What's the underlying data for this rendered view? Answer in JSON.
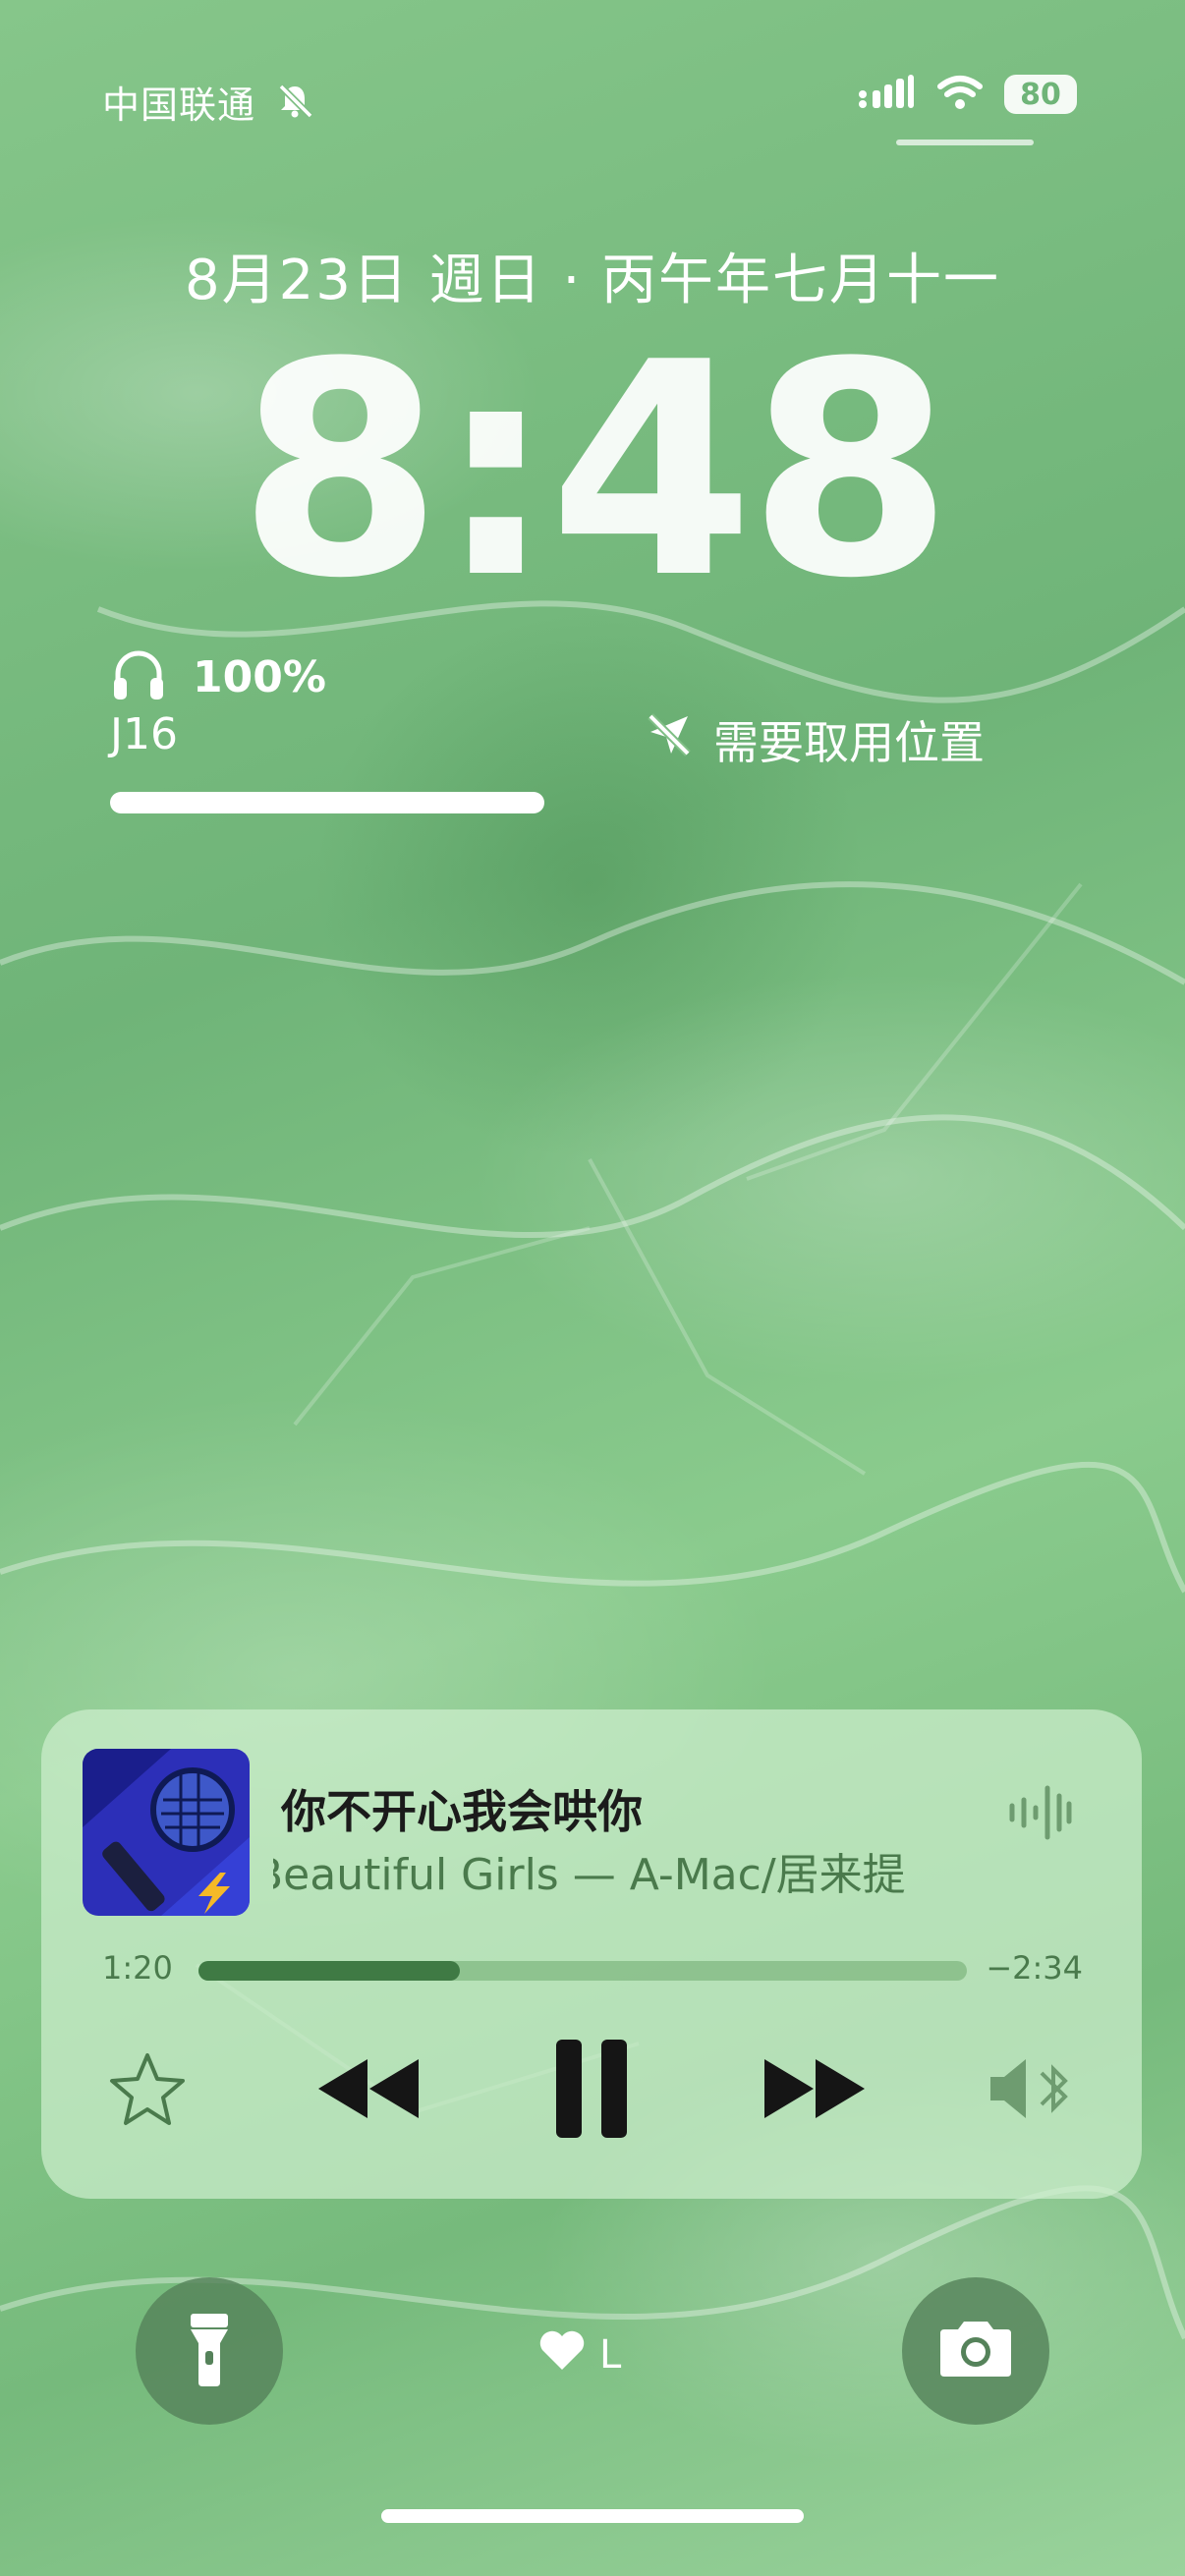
{
  "status_bar": {
    "carrier": "中国联通",
    "battery": "80"
  },
  "lockscreen": {
    "date": "8月23日 週日 · 丙午年七月十一",
    "time": "8:48"
  },
  "widgets": {
    "headphones": {
      "percent": "100%",
      "name": "J16",
      "level": 1.0
    },
    "location": {
      "text": "需要取用位置"
    }
  },
  "now_playing": {
    "title": "你不开心我会哄你",
    "artist_line": "Beautiful Girls — A-Mac/居来提",
    "elapsed": "1:20",
    "remaining": "−2:34",
    "progress": 0.34
  },
  "bottom": {
    "center_label": "L"
  },
  "colors": {
    "wallpaper": "#7fbf85",
    "player_bg": "#cdeecd",
    "accent": "#3f7a44"
  }
}
